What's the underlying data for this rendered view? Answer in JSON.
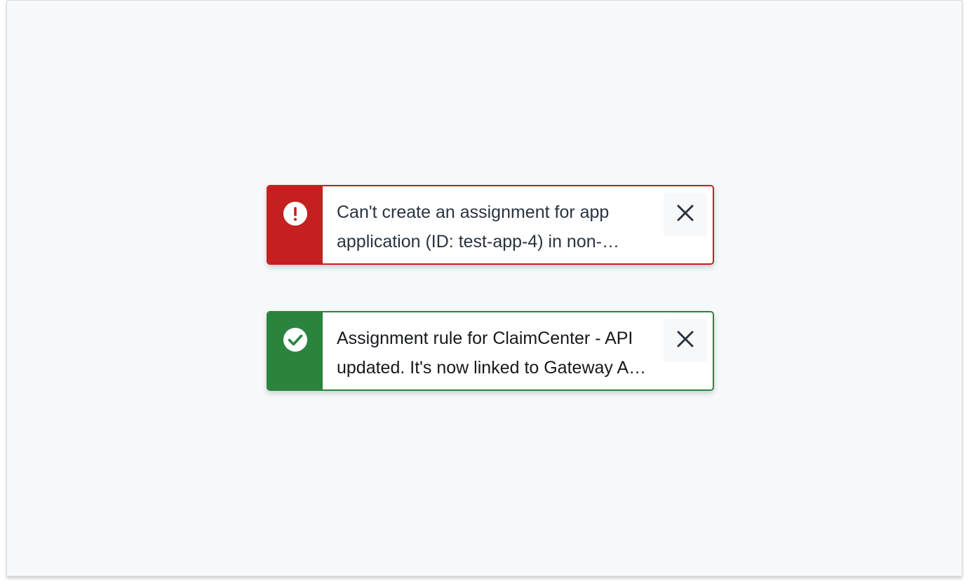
{
  "colors": {
    "error": "#c4201f",
    "success": "#2a843e",
    "background": "#f7f8fa"
  },
  "notifications": [
    {
      "type": "error",
      "icon": "exclamation-circle-icon",
      "message": "Can't create an assignment for app application (ID: test-app-4) in non-production environment. Check the configuration and try again.",
      "close_icon": "close-icon"
    },
    {
      "type": "success",
      "icon": "check-circle-icon",
      "message": "Assignment rule for ClaimCenter - API updated. It's now linked to Gateway API application.",
      "close_icon": "close-icon"
    }
  ]
}
